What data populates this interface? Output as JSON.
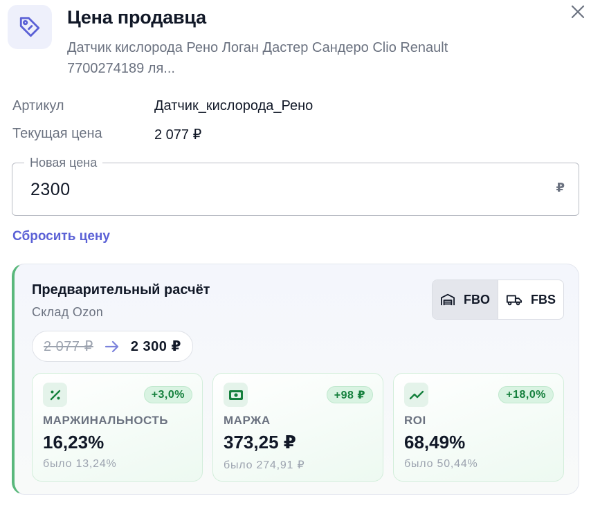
{
  "header": {
    "title": "Цена продавца",
    "subtitle": "Датчик кислорода Рено Логан Дастер Сандеро Clio Renault 7700274189 ля..."
  },
  "info": {
    "sku_label": "Артикул",
    "sku_value": "Датчик_кислорода_Рено",
    "current_price_label": "Текущая цена",
    "current_price_value": "2 077 ₽"
  },
  "new_price": {
    "label": "Новая цена",
    "value": "2300",
    "currency": "₽"
  },
  "reset_label": "Сбросить цену",
  "calc": {
    "title": "Предварительный расчёт",
    "subtitle": "Склад Ozon",
    "fbo_label": "FBO",
    "fbs_label": "FBS",
    "old_price": "2 077 ₽",
    "new_price": "2 300 ₽"
  },
  "metrics": [
    {
      "label": "МАРЖИНАЛЬНОСТЬ",
      "value": "16,23%",
      "delta": "+3,0%",
      "was": "было 13,24%",
      "icon": "percent-icon"
    },
    {
      "label": "МАРЖА",
      "value": "373,25 ₽",
      "delta": "+98 ₽",
      "was": "было 274,91 ₽",
      "icon": "banknote-icon"
    },
    {
      "label": "ROI",
      "value": "68,49%",
      "delta": "+18,0%",
      "was": "было 50,44%",
      "icon": "trend-up-icon"
    }
  ],
  "colors": {
    "accent": "#5b61d6",
    "positive": "#15803d",
    "card_border": "#5ab87c"
  }
}
